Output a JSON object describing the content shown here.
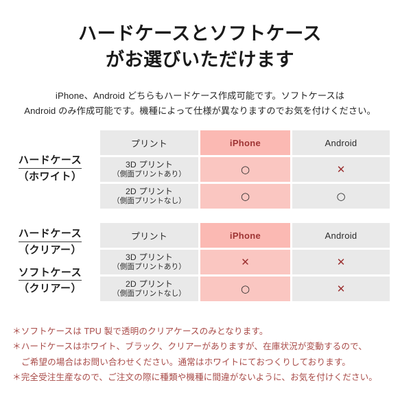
{
  "header": {
    "title_line1": "ハードケースとソフトケース",
    "title_line2": "がお選びいただけます",
    "subtitle_line1": "iPhone、Android どちらもハードケース作成可能です。ソフトケースは",
    "subtitle_line2": "Android のみ作成可能です。機種によって仕様が異なりますのでお気を付けください。"
  },
  "colors": {
    "pink_header": "#fbb9b3",
    "pink_cell": "#fac6c1",
    "grey_cell": "#e9e9e9",
    "iphone_text": "#9e3434",
    "cross_red": "#9b3030",
    "note_red": "#a84a47",
    "text_dark": "#231f20"
  },
  "marks": {
    "ok": "○",
    "ng": "✕"
  },
  "tables": [
    {
      "label": {
        "groups": [
          {
            "main": "ハードケース",
            "sub": "（ホワイト）"
          }
        ]
      },
      "columns": [
        "プリント",
        "iPhone",
        "Android"
      ],
      "rows": [
        {
          "print_main": "3D プリント",
          "print_sub": "（側面プリントあり）",
          "iphone": "○",
          "android": "✕"
        },
        {
          "print_main": "2D プリント",
          "print_sub": "（側面プリントなし）",
          "iphone": "○",
          "android": "○"
        }
      ]
    },
    {
      "label": {
        "groups": [
          {
            "main": "ハードケース",
            "sub": "（クリアー）"
          },
          {
            "main": "ソフトケース",
            "sub": "（クリアー）"
          }
        ]
      },
      "columns": [
        "プリント",
        "iPhone",
        "Android"
      ],
      "rows": [
        {
          "print_main": "3D プリント",
          "print_sub": "（側面プリントあり）",
          "iphone": "✕",
          "android": "✕"
        },
        {
          "print_main": "2D プリント",
          "print_sub": "（側面プリントなし）",
          "iphone": "○",
          "android": "✕"
        }
      ]
    }
  ],
  "notes": {
    "line1": "＊ソフトケースは TPU 製で透明のクリアケースのみとなります。",
    "line2": "＊ハードケースはホワイト、ブラック、クリアーがありますが、在庫状況が変動するので、",
    "line3": "ご希望の場合はお問い合わせください。通常はホワイトにておつくりしております。",
    "line4": "＊完全受注生産なので、ご注文の際に種類や機種に間違がないように、お気を付けください。"
  }
}
